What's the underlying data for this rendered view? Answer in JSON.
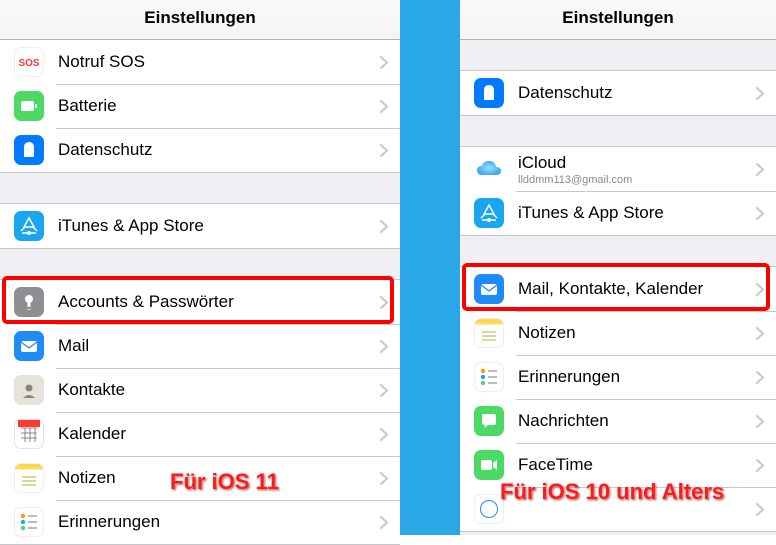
{
  "left": {
    "title": "Einstellungen",
    "caption": "Für iOS 11",
    "hl_name": "row-accounts-passwords",
    "groups": [
      [
        {
          "name": "row-sos",
          "icon": "sos",
          "label": "Notruf SOS"
        },
        {
          "name": "row-battery",
          "icon": "battery",
          "label": "Batterie"
        },
        {
          "name": "row-privacy",
          "icon": "privacy",
          "label": "Datenschutz"
        }
      ],
      [
        {
          "name": "row-itunes-appstore",
          "icon": "itunes",
          "label": "iTunes & App Store"
        }
      ],
      [
        {
          "name": "row-accounts-passwords",
          "icon": "accounts",
          "label": "Accounts & Passwörter"
        },
        {
          "name": "row-mail",
          "icon": "mail",
          "label": "Mail"
        },
        {
          "name": "row-contacts",
          "icon": "contacts",
          "label": "Kontakte"
        },
        {
          "name": "row-calendar",
          "icon": "calendar",
          "label": "Kalender"
        },
        {
          "name": "row-notes",
          "icon": "notes",
          "label": "Notizen"
        },
        {
          "name": "row-reminders",
          "icon": "reminders",
          "label": "Erinnerungen"
        }
      ]
    ]
  },
  "right": {
    "title": "Einstellungen",
    "caption": "Für iOS 10 und Alters",
    "hl_name": "row-mail-kontakte-kalender",
    "groups": [
      [
        {
          "name": "row-privacy-r",
          "icon": "privacy",
          "label": "Datenschutz"
        }
      ],
      [
        {
          "name": "row-icloud",
          "icon": "icloud",
          "label": "iCloud",
          "sub": "llddmm113@gmail.com"
        },
        {
          "name": "row-itunes-appstore-r",
          "icon": "itunes",
          "label": "iTunes & App Store"
        }
      ],
      [
        {
          "name": "row-mail-kontakte-kalender",
          "icon": "mail",
          "label": "Mail, Kontakte, Kalender"
        },
        {
          "name": "row-notes-r",
          "icon": "notes",
          "label": "Notizen"
        },
        {
          "name": "row-reminders-r",
          "icon": "reminders",
          "label": "Erinnerungen"
        },
        {
          "name": "row-messages",
          "icon": "messages",
          "label": "Nachrichten"
        },
        {
          "name": "row-facetime",
          "icon": "facetime",
          "label": "FaceTime"
        },
        {
          "name": "row-safari",
          "icon": "safari",
          "label": ""
        }
      ]
    ]
  }
}
